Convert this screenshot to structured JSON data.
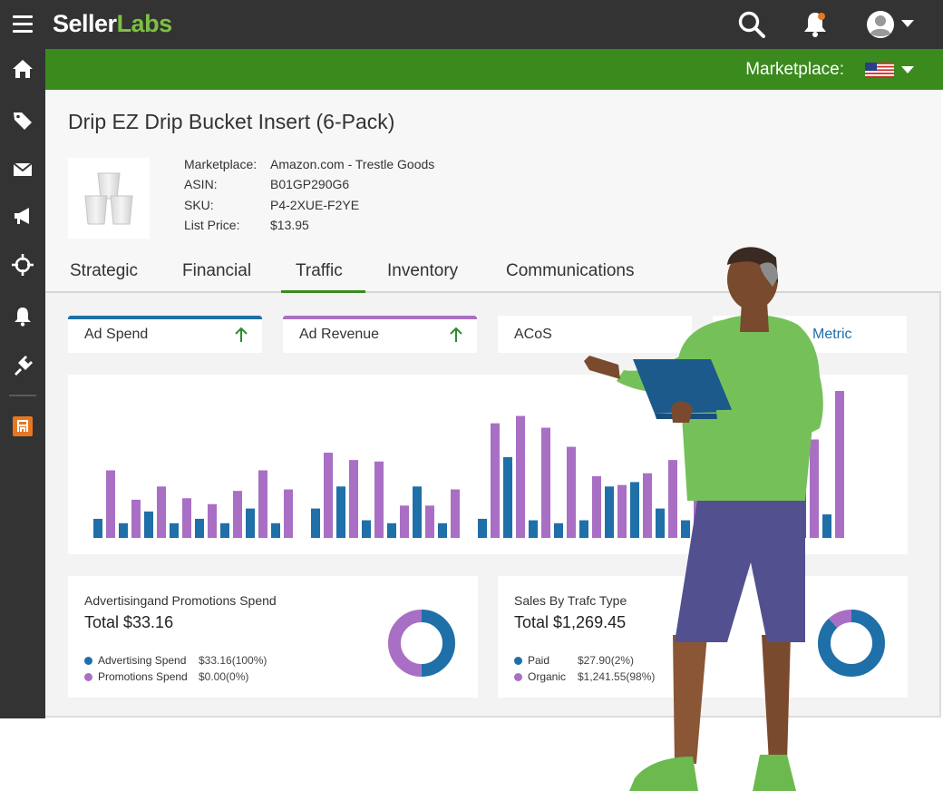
{
  "app": {
    "logo_primary": "Seller",
    "logo_secondary": "Labs"
  },
  "topbar": {
    "icons": [
      "menu-icon",
      "search-icon",
      "notification-bell-icon",
      "user-avatar-icon",
      "chevron-down-icon"
    ]
  },
  "sidebar": {
    "icons": [
      "home-icon",
      "tag-icon",
      "mail-icon",
      "megaphone-icon",
      "crosshair-icon",
      "bell-icon",
      "plugin-icon",
      "store-icon"
    ]
  },
  "marketplace_bar": {
    "label": "Marketplace:",
    "flag": "us-flag-icon"
  },
  "product": {
    "title": "Drip EZ Drip Bucket Insert (6-Pack)",
    "info": [
      {
        "key": "Marketplace:",
        "value": "Amazon.com - Trestle Goods"
      },
      {
        "key": "ASIN:",
        "value": "B01GP290G6"
      },
      {
        "key": "SKU:",
        "value": "P4-2XUE-F2YE"
      },
      {
        "key": "List Price:",
        "value": "$13.95"
      }
    ]
  },
  "tabs": [
    "Strategic",
    "Financial",
    "Traffic",
    "Inventory",
    "Communications"
  ],
  "active_tab": "Traffic",
  "metrics": [
    {
      "label": "Ad Spend",
      "accent": "#1f6fa8",
      "trend": "up"
    },
    {
      "label": "Ad Revenue",
      "accent": "#a86fc4",
      "trend": "up"
    },
    {
      "label": "ACoS",
      "accent": "",
      "trend": ""
    },
    {
      "label": "Metric",
      "accent": "",
      "trend": ""
    }
  ],
  "colors": {
    "blue": "#1f6fa8",
    "purple": "#a86fc4",
    "green": "#3b8a1e",
    "dark": "#333333",
    "trend_up": "#2e8b2e"
  },
  "chart_data": {
    "type": "bar",
    "grid": false,
    "ylim": [
      0,
      100
    ],
    "series": [
      {
        "name": "Ad Spend",
        "color": "#1f6fa8",
        "values": [
          13,
          10,
          18,
          10,
          13,
          10,
          20,
          10,
          20,
          35,
          12,
          10,
          35,
          10,
          13,
          55,
          12,
          10,
          12,
          35,
          38,
          20,
          12,
          42,
          45,
          60,
          55,
          16
        ]
      },
      {
        "name": "Ad Revenue",
        "color": "#a86fc4",
        "values": [
          46,
          26,
          35,
          27,
          23,
          32,
          46,
          33,
          58,
          53,
          52,
          22,
          22,
          33,
          78,
          83,
          75,
          62,
          42,
          36,
          44,
          53,
          85,
          82,
          88,
          82,
          67,
          100
        ]
      }
    ],
    "groups": [
      8,
      6,
      9,
      5
    ]
  },
  "summaries": [
    {
      "title": "Advertisingand Promotions Spend",
      "total": "Total $33.16",
      "legend": [
        {
          "name": "Advertising Spend",
          "value": "$33.16(100%)",
          "color": "#1f6fa8"
        },
        {
          "name": "Promotions Spend",
          "value": "$0.00(0%)",
          "color": "#a86fc4"
        }
      ],
      "donut": [
        {
          "label": "Advertising Spend",
          "value": 50
        },
        {
          "label": "Promotions Spend",
          "value": 50
        }
      ]
    },
    {
      "title": "Sales By Trafc Type",
      "total": "Total $1,269.45",
      "legend": [
        {
          "name": "Paid",
          "value": "$27.90(2%)",
          "color": "#1f6fa8"
        },
        {
          "name": "Organic",
          "value": "$1,241.55(98%)",
          "color": "#a86fc4"
        }
      ],
      "donut": [
        {
          "label": "Paid",
          "value": 88
        },
        {
          "label": "Organic",
          "value": 12
        }
      ]
    }
  ]
}
